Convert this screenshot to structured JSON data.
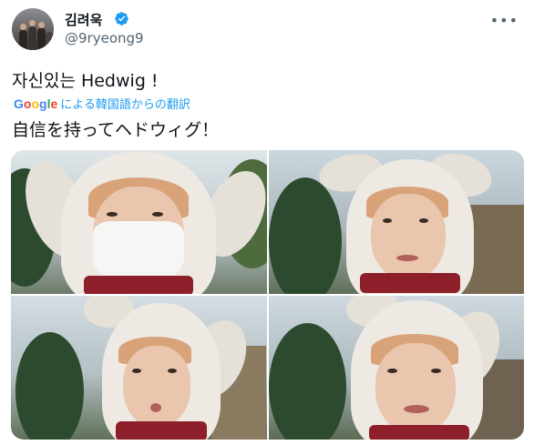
{
  "author": {
    "name": "김려욱",
    "handle": "@9ryeong9",
    "verified": true,
    "verified_color": "#1d9bf0"
  },
  "more_icon": "ellipsis-icon",
  "tweet": {
    "text": "자신있는 Hedwig !",
    "translate_suffix": "による韓国語からの翻訳",
    "translate_provider": "Google",
    "translated_text": "自信を持ってヘドウィグ！"
  },
  "photos": [
    {
      "label": "photo-1"
    },
    {
      "label": "photo-2"
    },
    {
      "label": "photo-3"
    },
    {
      "label": "photo-4"
    }
  ],
  "colors": {
    "link": "#1d9bf0",
    "secondary_text": "#536471",
    "scarf": "#8c1f2a"
  }
}
